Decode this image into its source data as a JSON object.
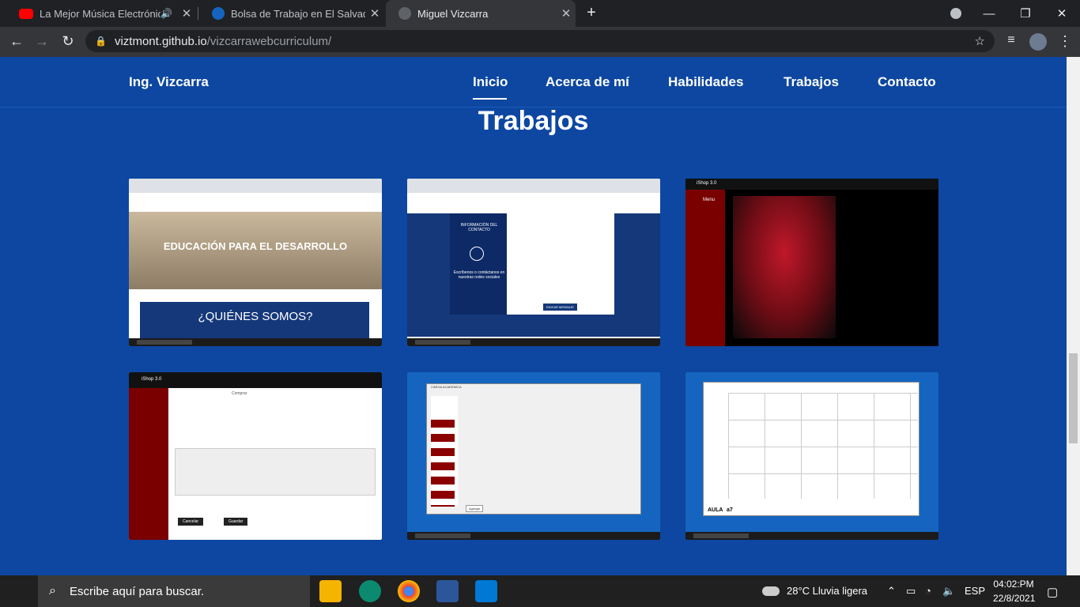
{
  "browser": {
    "tabs": [
      {
        "title": "La Mejor Música Electrónica",
        "icon": "youtube-icon",
        "audio": true
      },
      {
        "title": "Bolsa de Trabajo en El Salvador -",
        "icon": "site-icon"
      },
      {
        "title": "Miguel Vizcarra",
        "icon": "globe-icon",
        "active": true
      }
    ],
    "new_tab": "+",
    "url_host": "viztmont.github.io",
    "url_path": "/vizcarrawebcurriculum/"
  },
  "site": {
    "brand": "Ing. Vizcarra",
    "nav": [
      "Inicio",
      "Acerca de mí",
      "Habilidades",
      "Trabajos",
      "Contacto"
    ],
    "section_title": "Trabajos",
    "projects": [
      {
        "heading": "EDUCACIÓN PARA EL DESARROLLO",
        "subheading": "¿QUIÉNES SOMOS?"
      },
      {
        "heading": "INFORMACIÓN DEL CONTACTO",
        "subheading": "Escríbenos o contáctanos en nuestras redes sociales",
        "button": "ENVIAR MENSAJE"
      },
      {
        "heading": "iShop 3.0",
        "subheading": "Menu"
      },
      {
        "heading": "iShop 3.0",
        "subheading": "Comprar",
        "btn1": "Cancelar",
        "btn2": "Guardar"
      },
      {
        "heading": "CARGA ACADEMICA",
        "subheading": "Agregar"
      },
      {
        "heading": "AULA",
        "subheading": "a7"
      }
    ]
  },
  "taskbar": {
    "search_placeholder": "Escribe aquí para buscar.",
    "weather": "28°C  Lluvia ligera",
    "lang": "ESP",
    "time": "04:02:PM",
    "date": "22/8/2021"
  },
  "colors": {
    "site_bg": "#0d47a1",
    "tab_bg": "#202124",
    "accent_red": "#7a0000"
  }
}
